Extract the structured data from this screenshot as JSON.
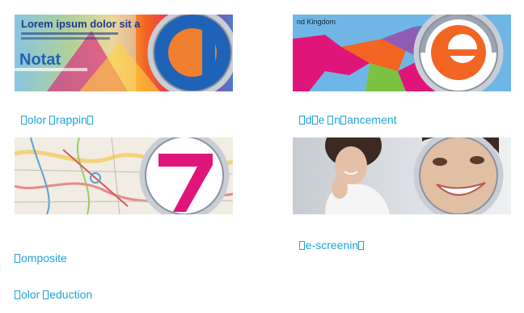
{
  "tiles": [
    {
      "caption_lines": [
        "▯ olor ▯ rappin▯"
      ],
      "glyph_letter": "d",
      "image_text": [
        "Lorem ipsum dolor sit a",
        "Notat"
      ],
      "accent": "#f08030",
      "accent2": "#1e63b8"
    },
    {
      "caption_lines": [
        "▯ d▯ e ▯ n▯ ancement"
      ],
      "glyph_letter": "e",
      "image_text": [
        "nd Kingdom"
      ],
      "accent": "#f26522",
      "accent2": "#8a9aa8"
    },
    {
      "caption_lines": [
        "▯ omposite",
        "▯ olor ▯ eduction"
      ],
      "glyph_letter": "7",
      "image_text": [],
      "accent": "#e0157a",
      "accent2": "#ffffff"
    },
    {
      "caption_lines": [
        "▯ e-screenin▯"
      ],
      "glyph_letter": "",
      "image_text": [],
      "accent": "#d9b79a",
      "accent2": "#ffffff"
    }
  ],
  "caption_color": "#1ea3d9",
  "icons": [
    "magnifier-icon"
  ]
}
